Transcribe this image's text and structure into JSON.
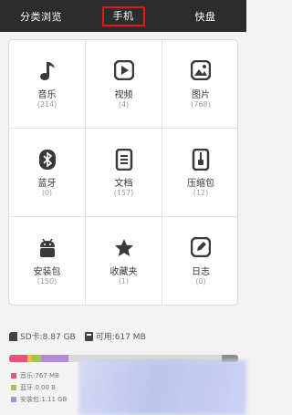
{
  "tabs": [
    {
      "label": "分类浏览"
    },
    {
      "label": "手机"
    },
    {
      "label": "快盘"
    }
  ],
  "categories": [
    {
      "name": "音乐",
      "count": "(214)",
      "icon": "music-note-icon"
    },
    {
      "name": "视频",
      "count": "(4)",
      "icon": "video-play-icon"
    },
    {
      "name": "图片",
      "count": "(768)",
      "icon": "image-icon"
    },
    {
      "name": "蓝牙",
      "count": "(0)",
      "icon": "bluetooth-icon"
    },
    {
      "name": "文档",
      "count": "(157)",
      "icon": "document-icon"
    },
    {
      "name": "压缩包",
      "count": "(12)",
      "icon": "zip-archive-icon"
    },
    {
      "name": "安装包",
      "count": "(150)",
      "icon": "android-package-icon"
    },
    {
      "name": "收藏夹",
      "count": "(1)",
      "icon": "star-icon"
    },
    {
      "name": "日志",
      "count": "(0)",
      "icon": "log-edit-icon"
    }
  ],
  "storage": {
    "sd_label": "SD卡:8.87 GB",
    "free_label": "可用:617 MB"
  },
  "usage_bar": {
    "segments": [
      {
        "color": "#e5537a",
        "fraction": 0.08
      },
      {
        "color": "#f0b93a",
        "fraction": 0.02
      },
      {
        "color": "#9ec84d",
        "fraction": 0.04
      },
      {
        "color": "#b48ad8",
        "fraction": 0.12
      },
      {
        "color": "#d9d9d9",
        "fraction": 0.67
      },
      {
        "color": "#8d8d8d",
        "fraction": 0.07
      }
    ]
  },
  "legend": [
    {
      "label": "音乐:767 MB",
      "color": "#e5537a"
    },
    {
      "label": "蓝牙:0.00 B",
      "color": "#9ec84d"
    },
    {
      "label": "安装包:1.11 GB",
      "color": "#b48ad8"
    }
  ],
  "colors": {
    "topbar": "#2c2c2c",
    "highlight": "#e4161a",
    "icon": "#3a3a3a"
  }
}
